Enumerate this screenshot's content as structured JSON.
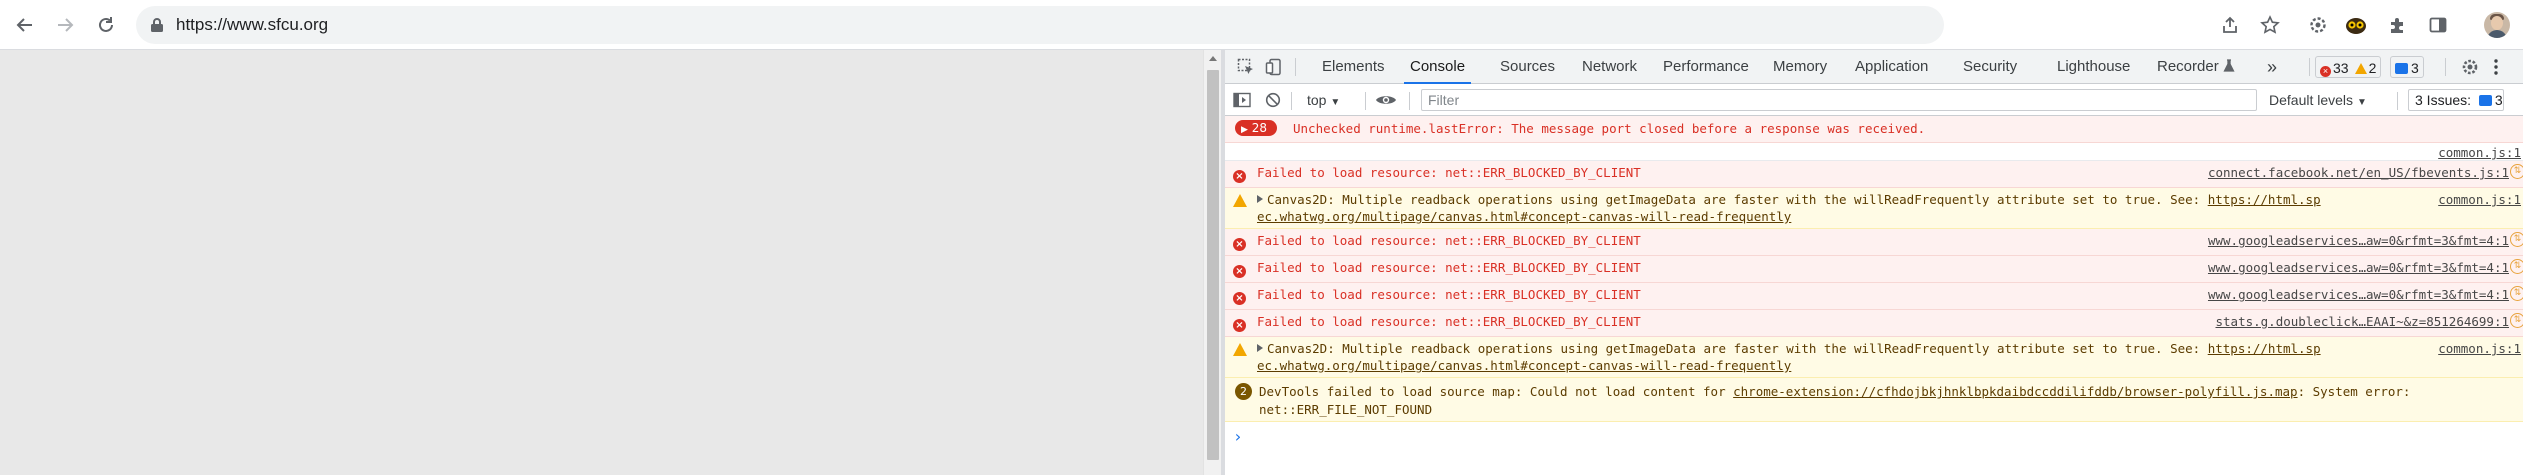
{
  "browser": {
    "url": "https://www.sfcu.org"
  },
  "devtools": {
    "tabs": [
      {
        "label": "Elements"
      },
      {
        "label": "Console",
        "active": true
      },
      {
        "label": "Sources"
      },
      {
        "label": "Network"
      },
      {
        "label": "Performance"
      },
      {
        "label": "Memory"
      },
      {
        "label": "Application"
      },
      {
        "label": "Security"
      },
      {
        "label": "Lighthouse"
      },
      {
        "label": "Recorder"
      }
    ],
    "counts": {
      "errors": "33",
      "warnings": "2",
      "messages": "3"
    },
    "filterbar": {
      "context": "top",
      "filter_placeholder": "Filter",
      "levels": "Default levels",
      "issues_label": "3 Issues:",
      "issues_count": "3"
    },
    "colors": {
      "accent": "#1a73e8",
      "error": "#d93025",
      "warning": "#f2a600"
    },
    "console": {
      "rows": [
        {
          "type": "error-group",
          "count": "28",
          "text": "Unchecked runtime.lastError: The message port closed before a response was received."
        },
        {
          "type": "plain",
          "source": "common.js:1"
        },
        {
          "type": "error",
          "text": "Failed to load resource: net::ERR_BLOCKED_BY_CLIENT",
          "source": "connect.facebook.net/en_US/fbevents.js:1"
        },
        {
          "type": "warning",
          "text": "Canvas2D: Multiple readback operations using getImageData are faster with the willReadFrequently attribute set to true. See: ",
          "link1": "https://html.sp",
          "link2": "ec.whatwg.org/multipage/canvas.html#concept-canvas-will-read-frequently",
          "source": "common.js:1"
        },
        {
          "type": "error",
          "text": "Failed to load resource: net::ERR_BLOCKED_BY_CLIENT",
          "source": "www.googleadservices…aw=0&rfmt=3&fmt=4:1"
        },
        {
          "type": "error",
          "text": "Failed to load resource: net::ERR_BLOCKED_BY_CLIENT",
          "source": "www.googleadservices…aw=0&rfmt=3&fmt=4:1"
        },
        {
          "type": "error",
          "text": "Failed to load resource: net::ERR_BLOCKED_BY_CLIENT",
          "source": "www.googleadservices…aw=0&rfmt=3&fmt=4:1"
        },
        {
          "type": "error",
          "text": "Failed to load resource: net::ERR_BLOCKED_BY_CLIENT",
          "source": "stats.g.doubleclick…EAAI~&z=851264699:1"
        },
        {
          "type": "warning",
          "text": "Canvas2D: Multiple readback operations using getImageData are faster with the willReadFrequently attribute set to true. See: ",
          "link1": "https://html.sp",
          "link2": "ec.whatwg.org/multipage/canvas.html#concept-canvas-will-read-frequently",
          "source": "common.js:1"
        },
        {
          "type": "warning-group",
          "count": "2",
          "text": "DevTools failed to load source map: Could not load content for ",
          "link1": "chrome-extension://cfhdojbkjhnklbpkdaibdccddilifddb/browser-polyfill.js.map",
          "text_after": ": System error:",
          "text2": "net::ERR_FILE_NOT_FOUND"
        }
      ]
    }
  }
}
